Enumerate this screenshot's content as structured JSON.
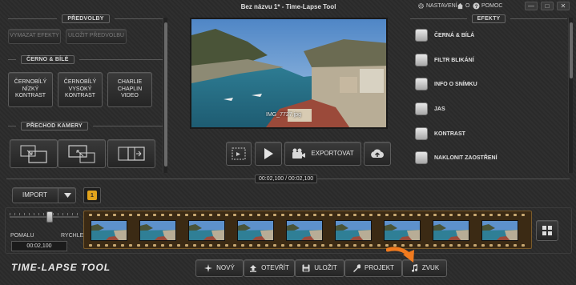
{
  "window": {
    "title": "Bez názvu 1* - Time-Lapse Tool",
    "links": {
      "settings": "NASTAVENÍ",
      "home": "O",
      "help": "POMOC"
    },
    "controls": {
      "minimize": "—",
      "maximize": "□",
      "close": "✕"
    }
  },
  "left_panel": {
    "presets": {
      "header": "PŘEDVOLBY",
      "clear_effects": "VYMAZAT EFEKTY",
      "save_preset": "ULOŽIT PŘEDVOLBU"
    },
    "bw": {
      "header": "ČERNO & BÍLÉ",
      "buttons": [
        "ČERNOBÍLÝ NÍZKÝ KONTRAST",
        "ČERNOBÍLÝ VYSOKÝ KONTRAST",
        "CHARLIE CHAPLIN VIDEO"
      ]
    },
    "camera": {
      "header": "PŘECHOD KAMERY"
    }
  },
  "preview": {
    "filename": "IMG_7727.jpg"
  },
  "controls": {
    "export": "EXPORTOVAT"
  },
  "effects": {
    "header": "EFEKTY",
    "items": [
      "ČERNÁ & BÍLÁ",
      "FILTR BLIKÁNÍ",
      "INFO O SNÍMKU",
      "JAS",
      "KONTRAST",
      "NAKLONIT ZAOSTŘENÍ"
    ]
  },
  "timeline": {
    "timecode": "00:02,100 / 00:02,100",
    "import": "IMPORT",
    "marker": "1",
    "speed": {
      "slow": "POMALU",
      "fast": "RYCHLE",
      "value": "00:02,100"
    },
    "thumbnail_count": 9
  },
  "toolbar": {
    "new": "NOVÝ",
    "open": "OTEVŘÍT",
    "save": "ULOŽIT",
    "project": "PROJEKT",
    "sound": "ZVUK"
  },
  "logo": "TIME-LAPSE TOOL",
  "colors": {
    "accent_orange": "#f07a1e",
    "marker_yellow": "#e2a31c",
    "film_strip": "#3b2a14"
  }
}
